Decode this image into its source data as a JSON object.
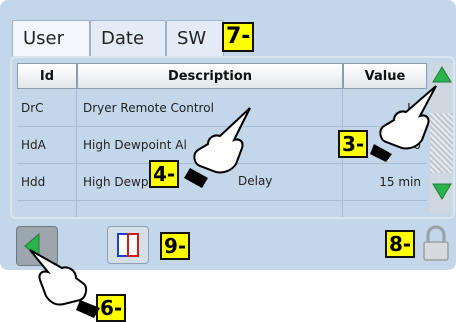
{
  "tabs": [
    {
      "label": "User",
      "active": true
    },
    {
      "label": "Date",
      "active": false
    },
    {
      "label": "SW",
      "active": false
    }
  ],
  "table": {
    "headers": [
      "Id",
      "Description",
      "Value"
    ],
    "rows": [
      {
        "id": "DrC",
        "description": "Dryer Remote Control",
        "value": "Lo"
      },
      {
        "id": "HdA",
        "description": "High Dewpoint Al",
        "value": "0"
      },
      {
        "id": "Hdd",
        "description": "High Dewp",
        "value": "15 min"
      },
      {
        "id": "",
        "description": "",
        "value": ""
      }
    ]
  },
  "callouts": {
    "c3": "3-",
    "c4": "4-",
    "c6": "6-",
    "c7": "7-",
    "c8": "8-",
    "c9": "9-",
    "c4_trailing": "Delay"
  },
  "colors": {
    "panel": "#c4d6ea",
    "arrow_green": "#2bb24c",
    "badge_yellow": "#ffff00"
  },
  "icons": [
    "scroll-up-arrow-icon",
    "scroll-down-arrow-icon",
    "back-arrow-icon",
    "language-book-icon",
    "padlock-icon",
    "pointing-hand-icon"
  ]
}
